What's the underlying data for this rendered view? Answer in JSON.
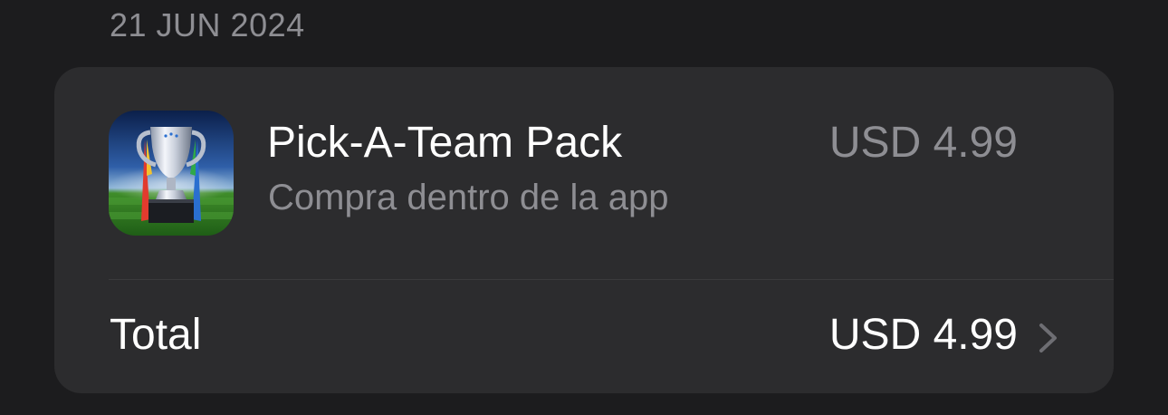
{
  "section": {
    "date": "21 JUN 2024"
  },
  "purchase": {
    "item": {
      "title": "Pick-A-Team Pack",
      "subtitle": "Compra dentro de la app",
      "price": "USD 4.99",
      "icon": "trophy-app-icon"
    },
    "total": {
      "label": "Total",
      "price": "USD 4.99",
      "icon": "chevron-right-icon"
    }
  },
  "colors": {
    "background": "#1c1c1e",
    "card": "#2c2c2e",
    "secondary_text": "#8e8e93",
    "primary_text": "#ffffff",
    "separator": "#3a3a3c"
  }
}
